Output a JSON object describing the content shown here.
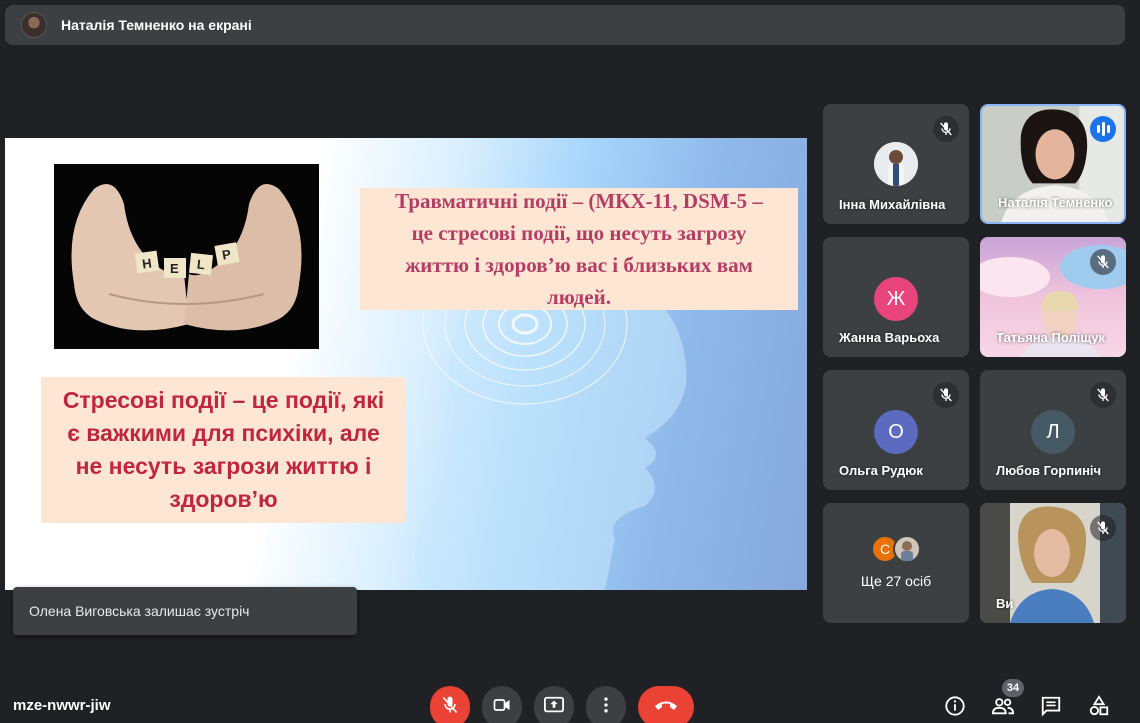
{
  "top_bar": {
    "presenter_label": "Наталія Темненко на екрані"
  },
  "slide": {
    "hands_word": "HELP",
    "box_top_text": "Травматичні події – (МКХ-11, DSM-5 –\nце стресові події, що несуть загрозу\nжиттю і здоров’ю вас і близьких вам\nлюдей.",
    "box_bottom_text": "Стресові події – це події, які\nє важкими для психіки, але\nне несуть загрози життю і\nздоров’ю"
  },
  "participants": [
    {
      "name": "Інна Михайлівна",
      "avatar_type": "photo",
      "muted": true
    },
    {
      "name": "Наталія Темненко",
      "avatar_type": "video",
      "speaking": true
    },
    {
      "name": "Жанна Варьоха",
      "avatar_type": "letter",
      "letter": "Ж",
      "color": "#e8457c",
      "muted": false
    },
    {
      "name": "Татьяна Поліщук",
      "avatar_type": "video",
      "muted": true
    },
    {
      "name": "Ольга Рудюк",
      "avatar_type": "letter",
      "letter": "О",
      "color": "#5c6bc0",
      "muted": true
    },
    {
      "name": "Любов Горпиніч",
      "avatar_type": "letter",
      "letter": "Л",
      "color": "#455a64",
      "muted": true
    },
    {
      "name": "Ви",
      "avatar_type": "video",
      "muted": true
    }
  ],
  "more_tile": {
    "mini_letter": "С",
    "mini_color": "#e8710a",
    "label": "Ще 27 осіб"
  },
  "toast": {
    "text": "Олена Виговська залишає зустріч"
  },
  "bottom_bar": {
    "meeting_code": "mze-nwwr-jiw",
    "participants_count": "34"
  },
  "icons": {
    "mic_off": "mic-off-icon",
    "camera": "videocam-icon",
    "present": "present-to-all-icon",
    "more": "more-vert-icon",
    "hangup": "call-end-icon",
    "info": "info-icon",
    "people": "people-icon",
    "chat": "chat-icon",
    "activities": "activities-icon"
  },
  "colors": {
    "bg": "#202124",
    "tile": "#3c4043",
    "red": "#ea4335",
    "active_border": "#8ab4f8",
    "speaking": "#1a73e8"
  }
}
